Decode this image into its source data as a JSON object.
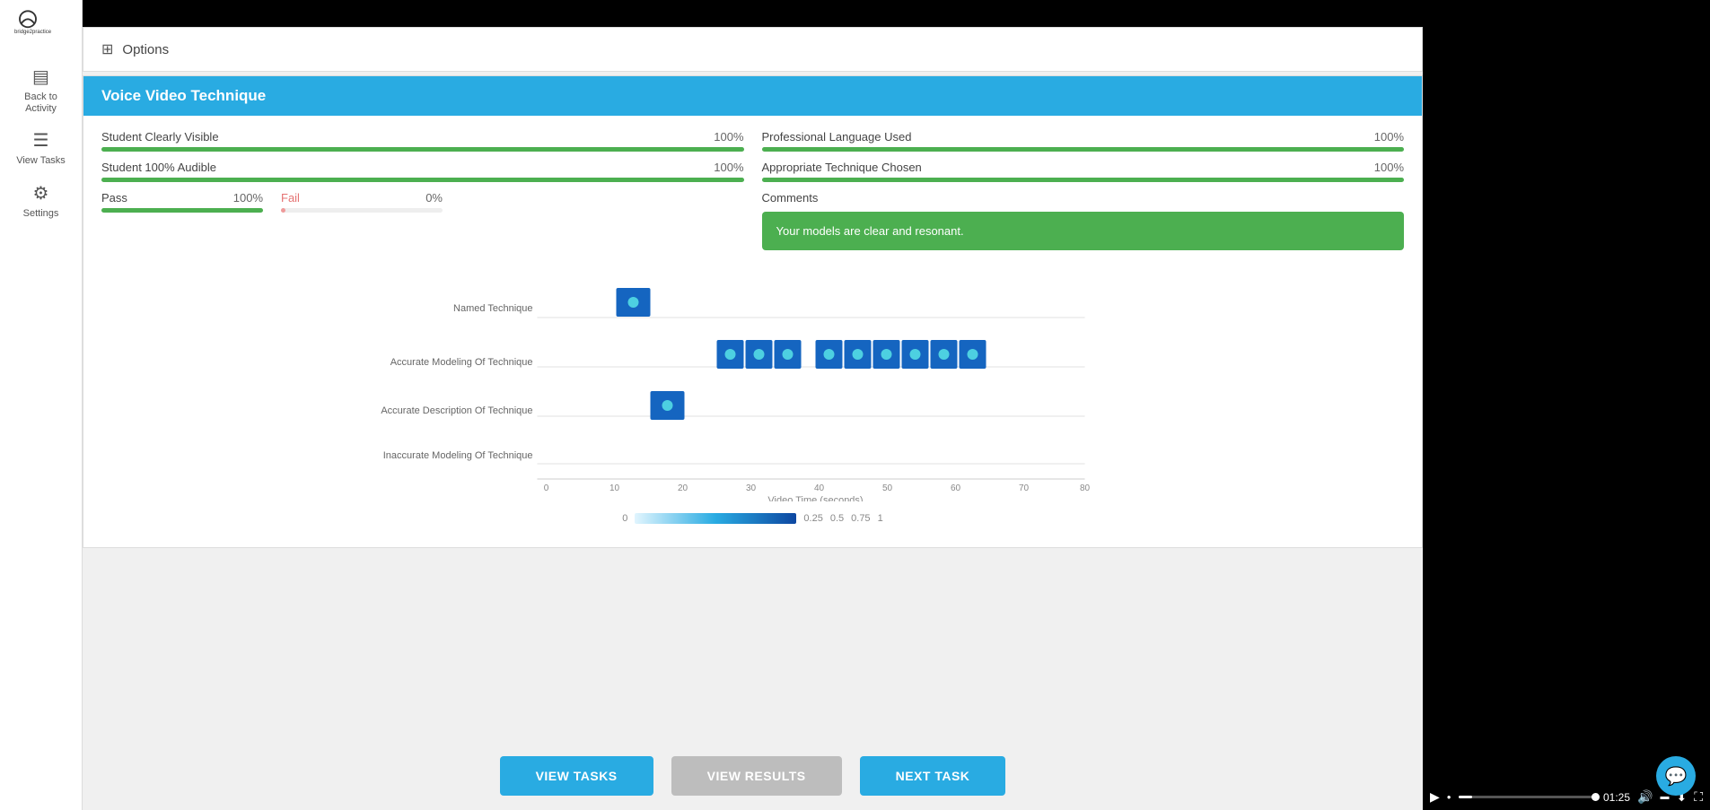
{
  "sidebar": {
    "logo_text": "bridge2practice",
    "items": [
      {
        "id": "back-to-activity",
        "icon": "▤",
        "label": "Back to\nActivity"
      },
      {
        "id": "view-tasks",
        "icon": "☰",
        "label": "View Tasks"
      },
      {
        "id": "settings",
        "icon": "⚙",
        "label": "Settings"
      }
    ]
  },
  "options_bar": {
    "icon": "⊞",
    "label": "Options"
  },
  "panel": {
    "header": "Voice Video Technique",
    "metrics": [
      {
        "label": "Student Clearly Visible",
        "value": "100%",
        "fill": 100,
        "color": "green"
      },
      {
        "label": "Professional Language Used",
        "value": "100%",
        "fill": 100,
        "color": "green"
      },
      {
        "label": "Student 100% Audible",
        "value": "100%",
        "fill": 100,
        "color": "green"
      },
      {
        "label": "Appropriate Technique Chosen",
        "value": "100%",
        "fill": 100,
        "color": "green"
      }
    ],
    "pass_label": "Pass",
    "pass_value": "100%",
    "fail_label": "Fail",
    "fail_value": "0%",
    "comments_label": "Comments",
    "comments_text": "Your models are clear and resonant."
  },
  "chart": {
    "title": "Video Time (seconds)",
    "y_labels": [
      "Named Technique",
      "Accurate Modeling Of Technique",
      "Accurate Description Of Technique",
      "Inaccurate Modeling Of Technique"
    ],
    "x_ticks": [
      0,
      10,
      20,
      30,
      40,
      50,
      60,
      70,
      80
    ],
    "scale_labels": [
      "0",
      "0.25",
      "0.5",
      "0.75",
      "1"
    ]
  },
  "buttons": {
    "view_tasks": "VIEW TASKS",
    "view_results": "VIEW RESULTS",
    "next_task": "NEXT TASK"
  },
  "video": {
    "time": "01:25"
  },
  "chat_icon": "💬"
}
